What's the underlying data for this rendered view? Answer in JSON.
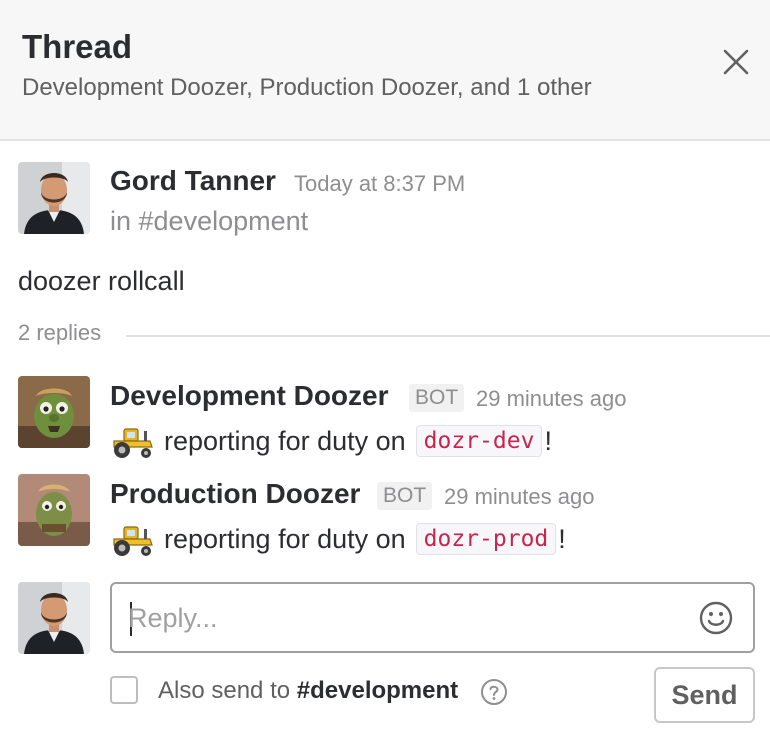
{
  "header": {
    "title": "Thread",
    "participants": "Development Doozer, Production Doozer, and 1 other"
  },
  "parent": {
    "author": "Gord Tanner",
    "timestamp": "Today at 8:37 PM",
    "channel": "in #development",
    "text": "doozer rollcall"
  },
  "replies": {
    "count": "2 replies",
    "items": [
      {
        "author": "Development Doozer",
        "badge": "BOT",
        "time": "29 minutes ago",
        "text": "reporting for duty on",
        "code": "dozr-dev",
        "suffix": "!"
      },
      {
        "author": "Production Doozer",
        "badge": "BOT",
        "time": "29 minutes ago",
        "text": "reporting for duty on",
        "code": "dozr-prod",
        "suffix": "!"
      }
    ]
  },
  "composer": {
    "placeholder": "Reply...",
    "also_send_prefix": "Also send to",
    "also_send_channel": "#development",
    "send_label": "Send"
  },
  "icons": {
    "close": "close-icon",
    "emoji": "emoji-icon",
    "help": "help-icon",
    "tractor": "tractor-emoji"
  },
  "colors": {
    "code_text": "#c7254e",
    "muted": "#8e8e90"
  }
}
